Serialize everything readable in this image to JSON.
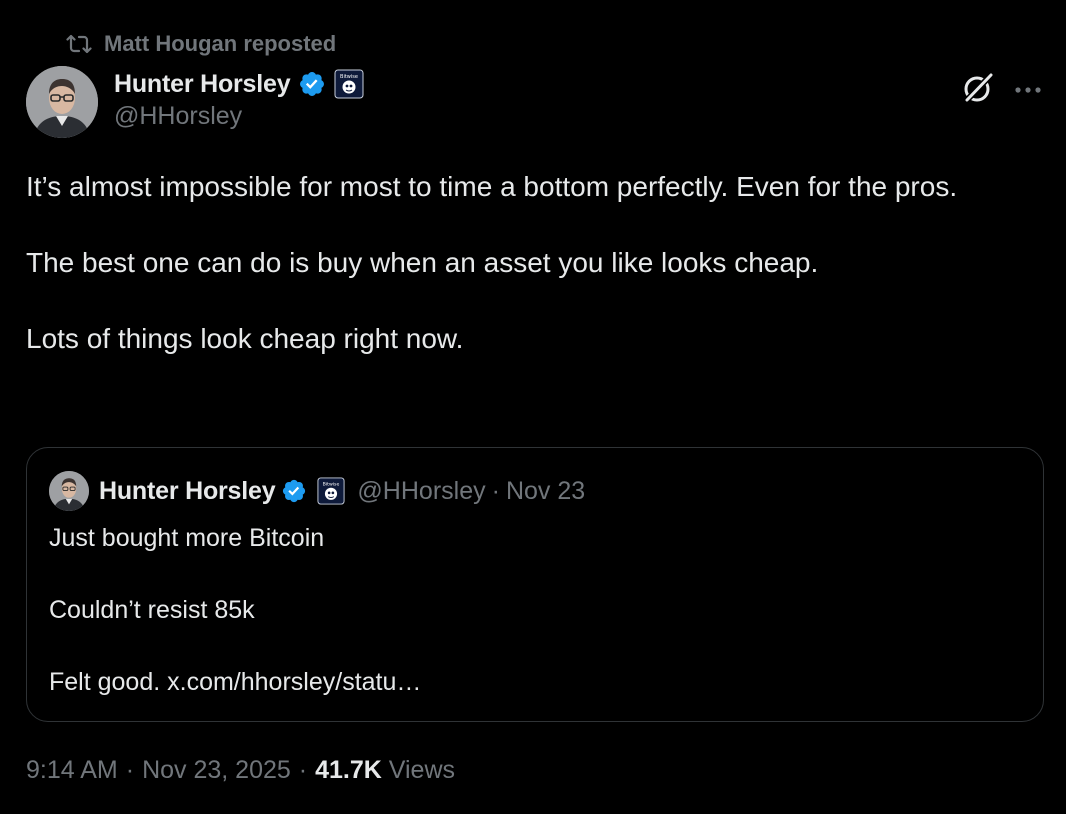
{
  "repost": {
    "icon": "repost-icon",
    "text": "Matt Hougan reposted"
  },
  "author": {
    "display_name": "Hunter Horsley",
    "handle": "@HHorsley",
    "verified_icon": "verified-badge-icon",
    "affiliation_icon": "bitwise-affiliate-badge",
    "affiliation_label": "Bitwise"
  },
  "actions": {
    "grok_icon": "grok-icon",
    "more_icon": "more-icon"
  },
  "tweet": {
    "paragraphs": [
      "It’s almost impossible for most to time a bottom perfectly. Even for the pros.",
      "The best one can do is buy when an asset you like looks cheap.",
      "Lots of things look cheap right now."
    ]
  },
  "quote": {
    "display_name": "Hunter Horsley",
    "handle": "@HHorsley",
    "separator": "·",
    "date": "Nov 23",
    "paragraphs": [
      "Just bought more Bitcoin",
      "Couldn’t resist 85k",
      "Felt good. x.com/hhorsley/statu…"
    ]
  },
  "meta": {
    "time": "9:14 AM",
    "date": "Nov 23, 2025",
    "separator": "·",
    "views_count": "41.7K",
    "views_label": "Views"
  },
  "colors": {
    "background": "#000000",
    "primary_text": "#e7e9ea",
    "secondary_text": "#71767b",
    "verified_blue": "#1d9bf0",
    "border": "#2f3336"
  }
}
